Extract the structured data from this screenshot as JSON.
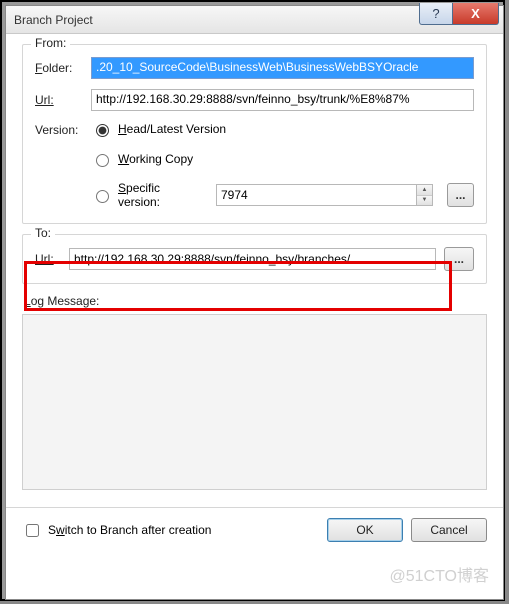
{
  "title": "Branch Project",
  "from": {
    "legend": "From:",
    "folder_label": "Folder:",
    "folder_value": ".20_10_SourceCode\\BusinessWeb\\BusinessWebBSYOracle",
    "url_label": "Url:",
    "url_value": "http://192.168.30.29:8888/svn/feinno_bsy/trunk/%E8%87%",
    "version_label": "Version:",
    "radio_head": "Head/Latest Version",
    "radio_working": "Working Copy",
    "radio_specific": "Specific version:",
    "specific_value": "7974",
    "browse": "..."
  },
  "to": {
    "legend": "To:",
    "url_label": "Url:",
    "url_value": "http://192.168.30.29:8888/svn/feinno_bsy/branches/",
    "browse": "..."
  },
  "log": {
    "label": "Log Message:",
    "value": ""
  },
  "footer": {
    "switch_label": "Switch to Branch after creation",
    "switch_checked": false,
    "ok": "OK",
    "cancel": "Cancel"
  },
  "window_buttons": {
    "help": "?",
    "close": "X"
  },
  "watermark": "@51CTO博客"
}
